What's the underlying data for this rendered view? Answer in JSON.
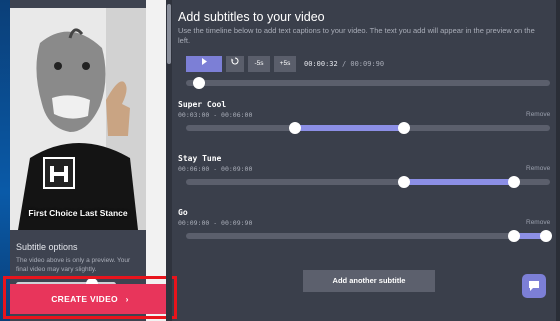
{
  "editor": {
    "title": "Add subtitles to your video",
    "description": "Use the timeline below to add text captions to your video. The text you add will appear in the preview on the left."
  },
  "preview": {
    "caption_text": "First Choice Last Stance",
    "options_title": "Subtitle options",
    "options_note": "The video above is only a preview. Your final video may vary slightly."
  },
  "player": {
    "play_icon": "play-icon",
    "reset_icon": "rewind-icon",
    "back_label": "-5s",
    "forward_label": "+5s",
    "current_time": "00:00:32",
    "separator": "/",
    "duration": "00:09:90",
    "progress_fraction": 0.02
  },
  "subtitles": [
    {
      "name": "Super Cool",
      "range": "00:03:00 - 00:06:00",
      "remove": "Remove",
      "start_fraction": 0.3,
      "end_fraction": 0.6
    },
    {
      "name": "Stay Tune",
      "range": "00:06:00 - 00:09:00",
      "remove": "Remove",
      "start_fraction": 0.6,
      "end_fraction": 0.9
    },
    {
      "name": "Go",
      "range": "00:09:00 - 00:09:90",
      "remove": "Remove",
      "start_fraction": 0.9,
      "end_fraction": 0.99
    }
  ],
  "actions": {
    "add_subtitle": "Add another subtitle",
    "create_video": "CREATE VIDEO",
    "create_arrow": "›"
  },
  "colors": {
    "accent": "#7c7fd6",
    "create": "#e8355b",
    "highlight": "#e8141c"
  }
}
